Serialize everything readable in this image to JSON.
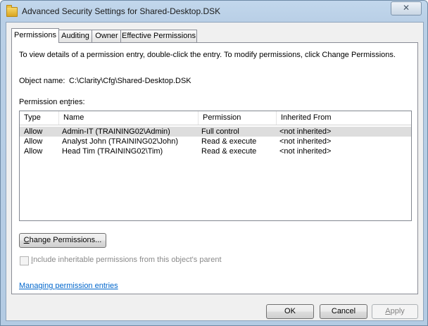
{
  "window": {
    "title": "Advanced Security Settings for Shared-Desktop.DSK",
    "close_glyph": "✕"
  },
  "tabs": [
    {
      "label": "Permissions"
    },
    {
      "label": "Auditing"
    },
    {
      "label": "Owner"
    },
    {
      "label": "Effective Permissions"
    }
  ],
  "permissions": {
    "instructions": "To view details of a permission entry, double-click the entry. To modify permissions, click Change Permissions.",
    "object_label": "Object name:",
    "object_value": "C:\\Clarity\\Cfg\\Shared-Desktop.DSK",
    "entries_label_pre": "Permission en",
    "entries_label_key": "t",
    "entries_label_post": "ries:",
    "columns": [
      "Type",
      "Name",
      "Permission",
      "Inherited From"
    ],
    "rows": [
      [
        "Allow",
        "Admin-IT (TRAINING02\\Admin)",
        "Full control",
        "<not inherited>"
      ],
      [
        "Allow",
        "Analyst John (TRAINING02\\John)",
        "Read & execute",
        "<not inherited>"
      ],
      [
        "Allow",
        "Head Tim (TRAINING02\\Tim)",
        "Read & execute",
        "<not inherited>"
      ]
    ],
    "change_key": "C",
    "change_rest": "hange Permissions...",
    "include_key": "I",
    "include_rest": "nclude inheritable permissions from this object's parent",
    "link": "Managing permission entries"
  },
  "buttons": {
    "ok": "OK",
    "cancel": "Cancel",
    "apply_key": "A",
    "apply_rest": "pply"
  }
}
